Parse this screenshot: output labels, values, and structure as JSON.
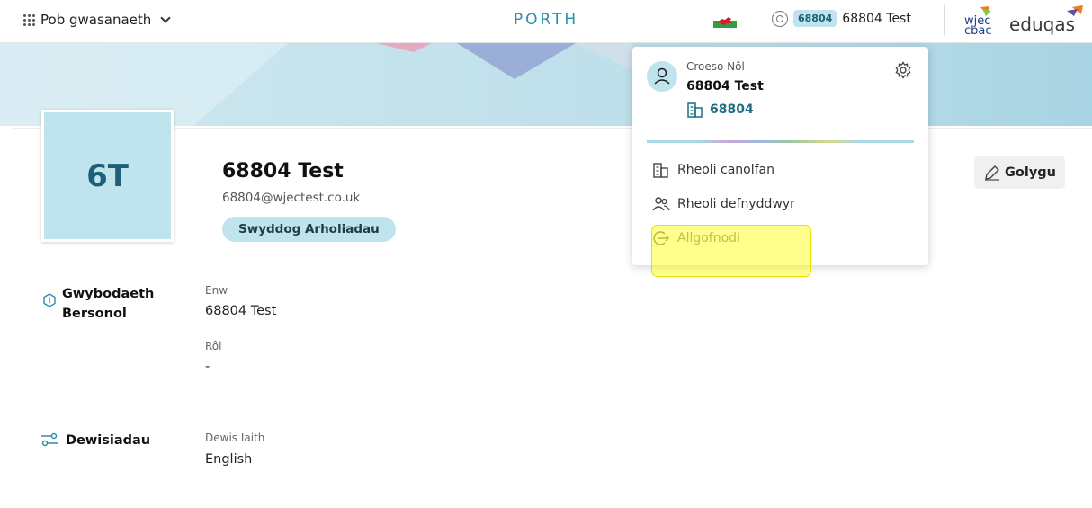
{
  "topbar": {
    "services_label": "Pob gwasanaeth",
    "brand": "PORTH",
    "centre_badge": "68804",
    "user_name": "68804 Test",
    "wjec_line1": "wjec",
    "wjec_line2": "cbac",
    "eduqas": "eduqas"
  },
  "profile": {
    "initials": "6T",
    "name": "68804 Test",
    "email": "68804@wjectest.co.uk",
    "role": "Swyddog Arholiadau",
    "edit_label": "Golygu"
  },
  "sections": {
    "personal": {
      "title_line1": "Gwybodaeth",
      "title_line2": "Bersonol",
      "fields": [
        {
          "label": "Enw",
          "value": "68804 Test"
        },
        {
          "label": "Rôl",
          "value": "-"
        }
      ]
    },
    "preferences": {
      "title": "Dewisiadau",
      "fields": [
        {
          "label": "Dewis Iaith",
          "value": "English"
        }
      ]
    }
  },
  "dropdown": {
    "welcome": "Croeso Nôl",
    "name": "68804 Test",
    "centre": "68804",
    "items": [
      {
        "label": "Rheoli canolfan",
        "icon": "building-icon"
      },
      {
        "label": "Rheoli defnyddwyr",
        "icon": "users-icon"
      },
      {
        "label": "Allgofnodi",
        "icon": "logout-icon"
      }
    ]
  },
  "colors": {
    "accent": "#2b8fae",
    "badge_bg": "#bfe4ee",
    "highlight": "#ffff00"
  }
}
